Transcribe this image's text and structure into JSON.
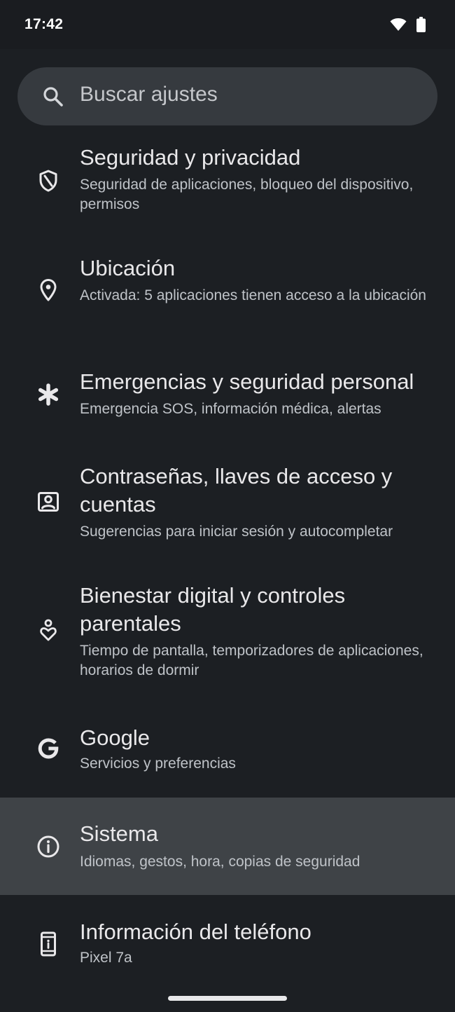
{
  "status_bar": {
    "time": "17:42",
    "icons": [
      "wifi-icon",
      "battery-icon"
    ]
  },
  "search": {
    "placeholder": "Buscar ajustes",
    "icon": "search-icon"
  },
  "settings": [
    {
      "id": "security",
      "icon": "shield-icon",
      "title": "Seguridad y privacidad",
      "subtitle": "Seguridad de aplicaciones, bloqueo del dispositivo, permisos"
    },
    {
      "id": "location",
      "icon": "location-pin-icon",
      "title": "Ubicación",
      "subtitle": "Activada: 5 aplicaciones tienen acceso a la ubicación"
    },
    {
      "id": "emergency",
      "icon": "asterisk-icon",
      "title": "Emergencias y seguridad personal",
      "subtitle": "Emergencia SOS, información médica, alertas"
    },
    {
      "id": "passwords",
      "icon": "account-box-icon",
      "title": "Contraseñas, llaves de acceso y cuentas",
      "subtitle": "Sugerencias para iniciar sesión y autocompletar"
    },
    {
      "id": "wellbeing",
      "icon": "wellbeing-icon",
      "title": "Bienestar digital y controles parentales",
      "subtitle": "Tiempo de pantalla, temporizadores de aplicaciones, horarios de dormir"
    },
    {
      "id": "google",
      "icon": "google-icon",
      "title": "Google",
      "subtitle": "Servicios y preferencias"
    },
    {
      "id": "system",
      "icon": "info-icon",
      "title": "Sistema",
      "subtitle": "Idiomas, gestos, hora, copias de seguridad",
      "highlighted": true
    },
    {
      "id": "phone-info",
      "icon": "phone-info-icon",
      "title": "Información del teléfono",
      "subtitle": "Pixel 7a"
    }
  ],
  "colors": {
    "background": "#1c1f23",
    "search_bg": "#363a3f",
    "highlight_bg": "#3f4347",
    "title_text": "#e9e8ea",
    "subtitle_text": "#bfc3c8"
  }
}
